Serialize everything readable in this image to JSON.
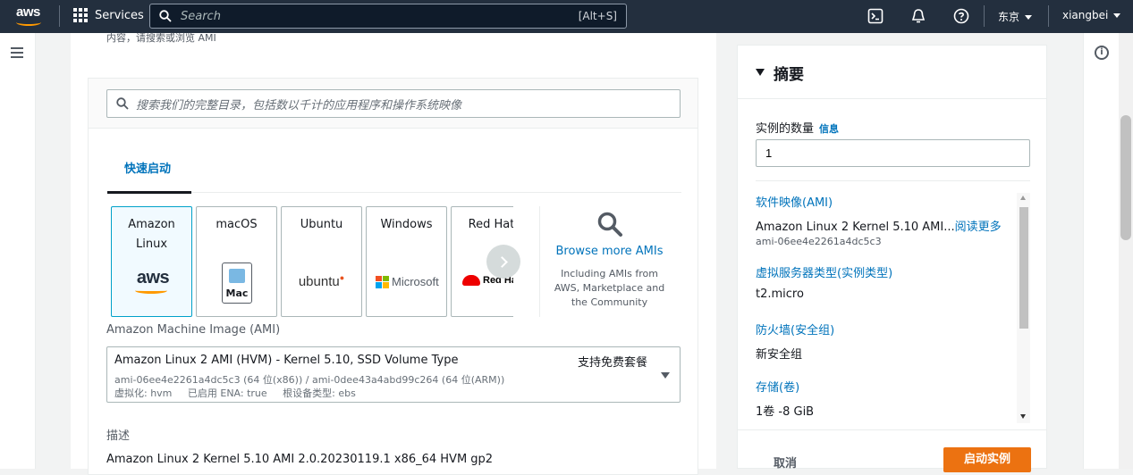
{
  "topnav": {
    "logo_text": "aws",
    "services_label": "Services",
    "search_placeholder": "Search",
    "search_shortcut": "[Alt+S]",
    "region": "东京",
    "user": "xiangbei"
  },
  "main": {
    "top_text": "内容，请搜索或浏览 AMI",
    "ami_search_placeholder": "搜索我们的完整目录，包括数以千计的应用程序和操作系统映像",
    "tab_label": "快速启动",
    "tiles": [
      {
        "name": "Amazon Linux",
        "logo": "aws"
      },
      {
        "name": "macOS",
        "logo": "Mac"
      },
      {
        "name": "Ubuntu",
        "logo": "ubuntu"
      },
      {
        "name": "Windows",
        "logo": "Microsoft"
      },
      {
        "name": "Red Hat",
        "logo": "Red Hat"
      }
    ],
    "browse_title": "Browse more AMIs",
    "browse_desc": "Including AMIs from AWS, Marketplace and the Community",
    "ami_label": "Amazon Machine Image (AMI)",
    "ami_selected": {
      "name": "Amazon Linux 2 AMI (HVM) - Kernel 5.10, SSD Volume Type",
      "badge": "支持免费套餐",
      "ids": "ami-06ee4e2261a4dc5c3 (64 位(x86)) / ami-0dee43a4abd99c264 (64 位(ARM))",
      "attrs": "虚拟化: hvm     已启用 ENA: true     根设备类型: ebs"
    },
    "desc_label": "描述",
    "desc_value": "Amazon Linux 2 Kernel 5.10 AMI 2.0.20230119.1 x86_64 HVM gp2"
  },
  "summary": {
    "title": "摘要",
    "count_label": "实例的数量",
    "count_info": "信息",
    "count_value": "1",
    "ami_key": "软件映像(AMI)",
    "ami_value": "Amazon Linux 2 Kernel 5.10 AMI...",
    "ami_more": "阅读更多",
    "ami_id": "ami-06ee4e2261a4dc5c3",
    "type_key": "虚拟服务器类型(实例类型)",
    "type_value": "t2.micro",
    "fw_key": "防火墙(安全组)",
    "fw_value": "新安全组",
    "storage_key": "存储(卷)",
    "storage_value": "1卷 -8 GiB",
    "cancel": "取消",
    "launch": "启动实例"
  },
  "colors": {
    "nav_bg": "#232f3e",
    "accent_orange": "#ec7211",
    "link_blue": "#0073bb",
    "selected_border": "#00a1c9"
  }
}
